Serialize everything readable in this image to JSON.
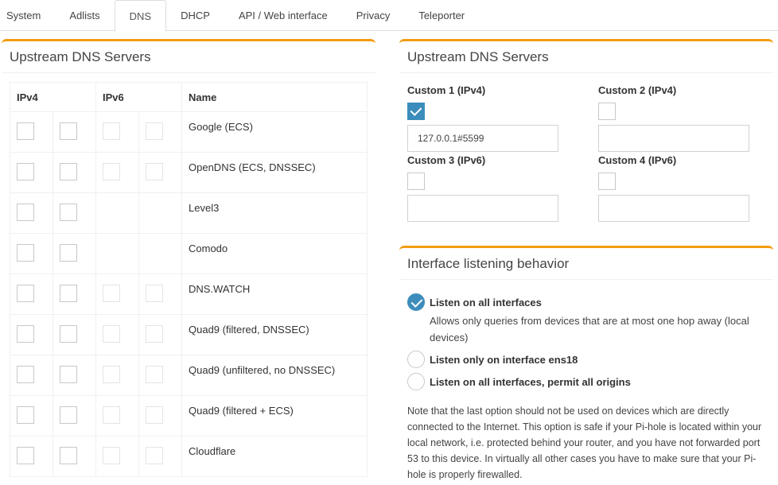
{
  "tabs": [
    {
      "label": "System",
      "active": false
    },
    {
      "label": "Adlists",
      "active": false
    },
    {
      "label": "DNS",
      "active": true
    },
    {
      "label": "DHCP",
      "active": false
    },
    {
      "label": "API / Web interface",
      "active": false
    },
    {
      "label": "Privacy",
      "active": false
    },
    {
      "label": "Teleporter",
      "active": false
    }
  ],
  "upstream_box": {
    "title": "Upstream DNS Servers",
    "headers": {
      "ipv4": "IPv4",
      "ipv6": "IPv6",
      "name": "Name"
    },
    "servers": [
      {
        "name": "Google (ECS)",
        "has_ipv6": true
      },
      {
        "name": "OpenDNS (ECS, DNSSEC)",
        "has_ipv6": true
      },
      {
        "name": "Level3",
        "has_ipv6": false
      },
      {
        "name": "Comodo",
        "has_ipv6": false
      },
      {
        "name": "DNS.WATCH",
        "has_ipv6": true
      },
      {
        "name": "Quad9 (filtered, DNSSEC)",
        "has_ipv6": true
      },
      {
        "name": "Quad9 (unfiltered, no DNSSEC)",
        "has_ipv6": true
      },
      {
        "name": "Quad9 (filtered + ECS)",
        "has_ipv6": true
      },
      {
        "name": "Cloudflare",
        "has_ipv6": true
      }
    ]
  },
  "custom_box": {
    "title": "Upstream DNS Servers",
    "custom1": {
      "label": "Custom 1 (IPv4)",
      "checked": true,
      "value": "127.0.0.1#5599"
    },
    "custom2": {
      "label": "Custom 2 (IPv4)",
      "checked": false,
      "value": ""
    },
    "custom3": {
      "label": "Custom 3 (IPv6)",
      "checked": false,
      "value": ""
    },
    "custom4": {
      "label": "Custom 4 (IPv6)",
      "checked": false,
      "value": ""
    }
  },
  "interface_box": {
    "title": "Interface listening behavior",
    "options": [
      {
        "label": "Listen on all interfaces",
        "checked": true,
        "description": "Allows only queries from devices that are at most one hop away (local devices)"
      },
      {
        "label": "Listen only on interface ens18",
        "checked": false
      },
      {
        "label": "Listen on all interfaces, permit all origins",
        "checked": false
      }
    ],
    "note": "Note that the last option should not be used on devices which are directly connected to the Internet. This option is safe if your Pi-hole is located within your local network, i.e. protected behind your router, and you have not forwarded port 53 to this device. In virtually all other cases you have to make sure that your Pi-hole is properly firewalled."
  },
  "colors": {
    "accent": "#3c8dbc",
    "box_border": "#f39c12"
  }
}
